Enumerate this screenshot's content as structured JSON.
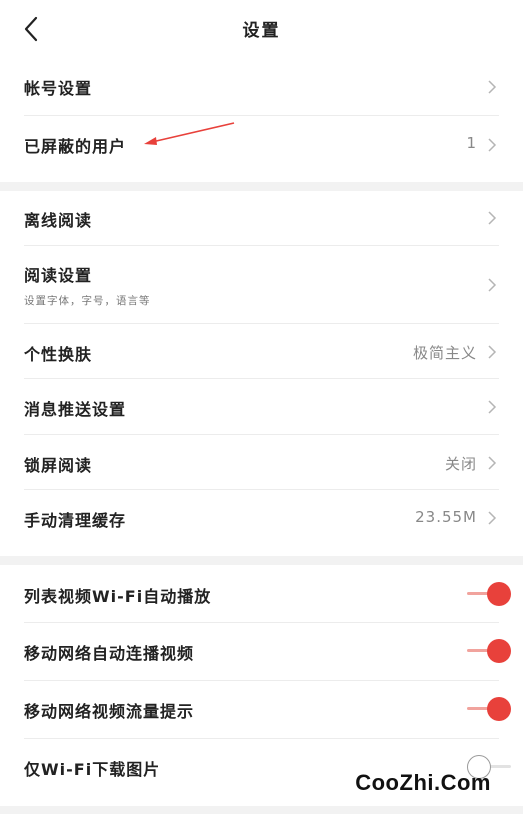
{
  "header": {
    "title": "设置"
  },
  "section1": [
    {
      "label": "帐号设置",
      "value": ""
    },
    {
      "label": "已屏蔽的用户",
      "value": "1"
    }
  ],
  "section2": [
    {
      "label": "离线阅读",
      "value": ""
    },
    {
      "label": "阅读设置",
      "sub": "设置字体，字号，语言等",
      "value": ""
    },
    {
      "label": "个性换肤",
      "value": "极简主义"
    },
    {
      "label": "消息推送设置",
      "value": ""
    },
    {
      "label": "锁屏阅读",
      "value": "关闭"
    },
    {
      "label": "手动清理缓存",
      "value": "23.55M"
    }
  ],
  "section3": [
    {
      "label": "列表视频Wi-Fi自动播放",
      "on": true
    },
    {
      "label": "移动网络自动连播视频",
      "on": true
    },
    {
      "label": "移动网络视频流量提示",
      "on": true
    },
    {
      "label": "仅Wi-Fi下载图片",
      "on": false
    }
  ],
  "watermark": "CooZhi.Com",
  "colors": {
    "accent": "#e8413b",
    "annotation_arrow": "#e8413b",
    "divider": "#f2f2f2"
  },
  "icons": {
    "back": "chevron-left-icon",
    "row": "chevron-right-icon"
  }
}
